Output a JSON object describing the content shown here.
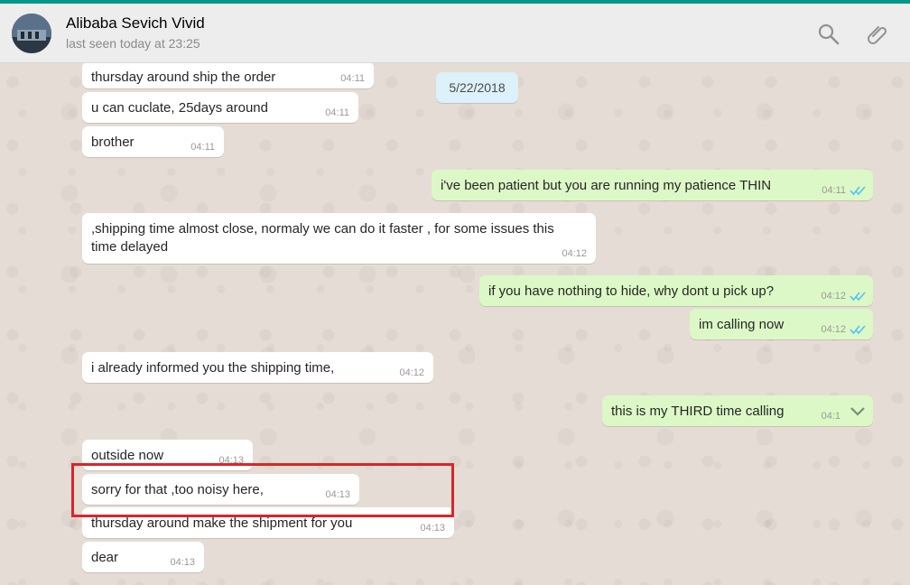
{
  "header": {
    "contact_name": "Alibaba Sevich Vivid",
    "status": "last seen today at 23:25",
    "icons": {
      "search": "search-icon",
      "attach": "paperclip-icon"
    }
  },
  "colors": {
    "accent": "#009688",
    "incoming": "#ffffff",
    "outgoing": "#dcf8c6",
    "date_chip": "#dcf1f9",
    "read_ticks": "#4fc3f7",
    "highlight": "#d9252a"
  },
  "date_label": "5/22/2018",
  "messages": [
    {
      "dir": "in",
      "text": "thursday around ship the order",
      "time": "04:11"
    },
    {
      "dir": "in",
      "text": "u can cuclate, 25days around",
      "time": "04:11"
    },
    {
      "dir": "in",
      "text": "brother",
      "time": "04:11"
    },
    {
      "dir": "out",
      "text": "i've been patient but you are running my patience THIN",
      "time": "04:11",
      "status": "read"
    },
    {
      "dir": "in",
      "text": ",shipping time almost close, normaly we can do it faster , for some issues this time delayed",
      "time": "04:12"
    },
    {
      "dir": "out",
      "text": "if you have nothing to hide, why dont u pick up?",
      "time": "04:12",
      "status": "read"
    },
    {
      "dir": "out",
      "text": "im calling now",
      "time": "04:12",
      "status": "read"
    },
    {
      "dir": "in",
      "text": "i already informed you the shipping time,",
      "time": "04:12"
    },
    {
      "dir": "out",
      "text": "this is my THIRD time calling",
      "time": "04:1",
      "menu_icon": "chevron-down-icon"
    },
    {
      "dir": "in",
      "text": "outside now",
      "time": "04:13"
    },
    {
      "dir": "in",
      "text": "sorry for that ,too noisy here,",
      "time": "04:13",
      "highlighted": true
    },
    {
      "dir": "in",
      "text": "thursday around make the shipment for you",
      "time": "04:13"
    },
    {
      "dir": "in",
      "text": "dear",
      "time": "04:13"
    }
  ]
}
